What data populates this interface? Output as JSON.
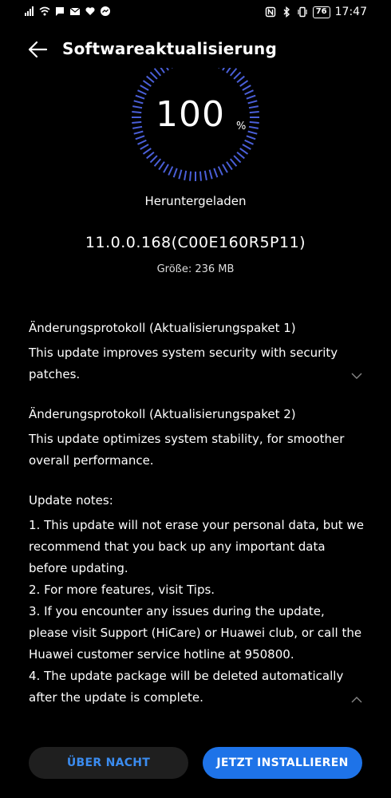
{
  "status_bar": {
    "left_icons": [
      "signal-icon",
      "wifi-icon",
      "message-icon",
      "mail-icon",
      "heart-icon",
      "messenger-icon"
    ],
    "right_icons": [
      "nfc-icon",
      "bluetooth-icon",
      "vibrate-icon"
    ],
    "battery": "76",
    "time": "17:47"
  },
  "header": {
    "title": "Softwareaktualisierung",
    "back_icon": "back-arrow-icon"
  },
  "progress": {
    "percent_value": "100",
    "percent_sign": "%",
    "fraction": 1.0,
    "status": "Heruntergeladen",
    "accent_color": "#4a5fd8"
  },
  "package": {
    "version": "11.0.0.168(C00E160R5P11)",
    "size": "Größe: 236 MB"
  },
  "changelog": [
    {
      "heading": "Änderungsprotokoll (Aktualisierungspaket 1)",
      "body": "This update improves system security with security patches."
    },
    {
      "heading": "Änderungsprotokoll (Aktualisierungspaket 2)",
      "body": "This update optimizes system stability, for smoother overall performance."
    }
  ],
  "notes": {
    "heading": "Update notes:",
    "items": [
      "1. This update will not erase your personal data, but we recommend that you back up any important data before updating.",
      "2. For more features, visit Tips.",
      "3. If you encounter any issues during the update, please visit Support (HiCare) or Huawei club, or call the Huawei customer service hotline at 950800.",
      "4. The update package will be deleted automatically after the update is complete."
    ]
  },
  "buttons": {
    "later": "ÜBER NACHT",
    "install": "JETZT INSTALLIEREN"
  },
  "colors": {
    "primary_button": "#1e73e8",
    "secondary_text": "#3b8cf0",
    "background": "#000000"
  }
}
